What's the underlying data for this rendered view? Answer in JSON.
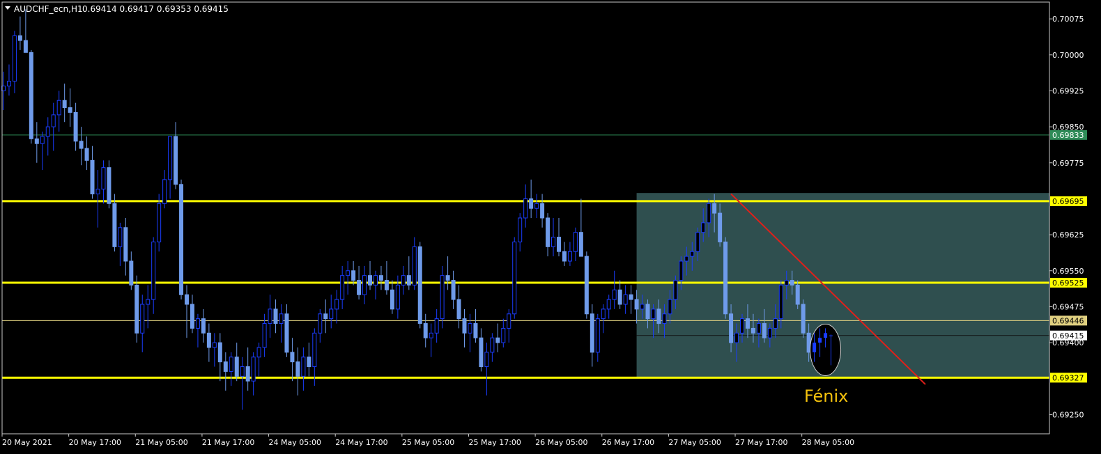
{
  "header": {
    "symbol": "AUDCHF_ecn,H1",
    "ohlc": "0.69414 0.69417 0.69353 0.69415"
  },
  "colors": {
    "background": "#000000",
    "frame": "#ffffff",
    "bull_candle": "#1a3dff",
    "bear_candle": "#6f9bea",
    "support_resistance": "#ffff00",
    "green_level": "#2e8b57",
    "mid_level": "#e0d080",
    "box_fill": "#2f4f4f",
    "trendline": "#e0201a",
    "annotation": "#f4c20d"
  },
  "annotation": {
    "label": "Fénix",
    "marker": "ellipse"
  },
  "chart_data": {
    "type": "candlestick",
    "symbol": "AUDCHF_ecn",
    "timeframe": "H1",
    "ylim": [
      0.6921,
      0.7011
    ],
    "y_ticks": [
      {
        "value": 0.70075,
        "label": "0.70075"
      },
      {
        "value": 0.7,
        "label": "0.70000"
      },
      {
        "value": 0.69925,
        "label": "0.69925"
      },
      {
        "value": 0.6985,
        "label": "0.69850"
      },
      {
        "value": 0.69775,
        "label": "0.69775"
      },
      {
        "value": 0.69625,
        "label": "0.69625"
      },
      {
        "value": 0.6955,
        "label": "0.69550"
      },
      {
        "value": 0.69475,
        "label": "0.69475"
      },
      {
        "value": 0.694,
        "label": "0.69400"
      },
      {
        "value": 0.6925,
        "label": "0.69250"
      }
    ],
    "x_ticks": [
      {
        "bar": 0,
        "label": "20 May 2021"
      },
      {
        "bar": 12,
        "label": "20 May 17:00"
      },
      {
        "bar": 24,
        "label": "21 May 05:00"
      },
      {
        "bar": 36,
        "label": "21 May 17:00"
      },
      {
        "bar": 48,
        "label": "24 May 05:00"
      },
      {
        "bar": 60,
        "label": "24 May 17:00"
      },
      {
        "bar": 72,
        "label": "25 May 05:00"
      },
      {
        "bar": 84,
        "label": "25 May 17:00"
      },
      {
        "bar": 96,
        "label": "26 May 05:00"
      },
      {
        "bar": 108,
        "label": "26 May 17:00"
      },
      {
        "bar": 120,
        "label": "27 May 05:00"
      },
      {
        "bar": 132,
        "label": "27 May 17:00"
      },
      {
        "bar": 144,
        "label": "28 May 05:00"
      }
    ],
    "levels": [
      {
        "name": "resistance",
        "value": 0.69833,
        "label": "0.69833",
        "style": "green"
      },
      {
        "name": "resistance",
        "value": 0.69695,
        "label": "0.69695",
        "style": "yellow"
      },
      {
        "name": "support",
        "value": 0.69525,
        "label": "0.69525",
        "style": "yellow"
      },
      {
        "name": "mid",
        "value": 0.69446,
        "label": "0.69446",
        "style": "thin"
      },
      {
        "name": "support",
        "value": 0.69327,
        "label": "0.69327",
        "style": "yellow"
      }
    ],
    "current_price": {
      "value": 0.69415,
      "label": "0.69415"
    },
    "range_box": {
      "bar_start": 114,
      "bar_end": 190,
      "price_top": 0.69712,
      "price_bottom": 0.69328
    },
    "trendline": {
      "bar1": 131,
      "price1": 0.6971,
      "bar2": 166,
      "price2": 0.69313
    },
    "fenix_marker": {
      "bar": 148,
      "price": 0.69385
    },
    "candles": [
      [
        0.69925,
        0.69965,
        0.69885,
        0.69935
      ],
      [
        0.69935,
        0.6998,
        0.69915,
        0.69945
      ],
      [
        0.69945,
        0.7005,
        0.6992,
        0.7004
      ],
      [
        0.7004,
        0.7008,
        0.7001,
        0.7003
      ],
      [
        0.7003,
        0.70095,
        0.7001,
        0.70005
      ],
      [
        0.70005,
        0.7001,
        0.69815,
        0.69825
      ],
      [
        0.69825,
        0.6986,
        0.69775,
        0.69815
      ],
      [
        0.69815,
        0.6984,
        0.6976,
        0.6983
      ],
      [
        0.6983,
        0.6987,
        0.6979,
        0.6985
      ],
      [
        0.6985,
        0.699,
        0.698,
        0.69875
      ],
      [
        0.69875,
        0.69925,
        0.6984,
        0.69905
      ],
      [
        0.69905,
        0.6994,
        0.6986,
        0.6989
      ],
      [
        0.6989,
        0.6993,
        0.6985,
        0.6988
      ],
      [
        0.6988,
        0.699,
        0.698,
        0.6982
      ],
      [
        0.6982,
        0.6985,
        0.6977,
        0.69805
      ],
      [
        0.69805,
        0.6983,
        0.6976,
        0.6978
      ],
      [
        0.6978,
        0.6981,
        0.697,
        0.6971
      ],
      [
        0.6971,
        0.6976,
        0.6964,
        0.6972
      ],
      [
        0.6972,
        0.6978,
        0.6969,
        0.69765
      ],
      [
        0.69765,
        0.6978,
        0.6968,
        0.6969
      ],
      [
        0.6969,
        0.6971,
        0.6959,
        0.696
      ],
      [
        0.696,
        0.6965,
        0.6956,
        0.6964
      ],
      [
        0.6964,
        0.6966,
        0.6954,
        0.6957
      ],
      [
        0.6957,
        0.6959,
        0.6951,
        0.6952
      ],
      [
        0.6952,
        0.6954,
        0.694,
        0.6942
      ],
      [
        0.6942,
        0.695,
        0.6938,
        0.6948
      ],
      [
        0.6948,
        0.6952,
        0.6943,
        0.6949
      ],
      [
        0.6949,
        0.6962,
        0.6946,
        0.6961
      ],
      [
        0.6961,
        0.6971,
        0.6959,
        0.6969
      ],
      [
        0.6969,
        0.6976,
        0.6968,
        0.6974
      ],
      [
        0.6974,
        0.6983,
        0.697,
        0.6983
      ],
      [
        0.6983,
        0.6986,
        0.6972,
        0.6973
      ],
      [
        0.6973,
        0.6974,
        0.6949,
        0.695
      ],
      [
        0.695,
        0.6952,
        0.6941,
        0.6948
      ],
      [
        0.6948,
        0.695,
        0.6942,
        0.6943
      ],
      [
        0.6943,
        0.6946,
        0.6939,
        0.6945
      ],
      [
        0.6945,
        0.6947,
        0.694,
        0.6942
      ],
      [
        0.6942,
        0.6944,
        0.6936,
        0.6939
      ],
      [
        0.6939,
        0.6942,
        0.6935,
        0.694
      ],
      [
        0.694,
        0.6942,
        0.6932,
        0.6936
      ],
      [
        0.6936,
        0.6938,
        0.693,
        0.6934
      ],
      [
        0.6934,
        0.6938,
        0.6931,
        0.6937
      ],
      [
        0.6937,
        0.694,
        0.6932,
        0.6933
      ],
      [
        0.6933,
        0.6937,
        0.6926,
        0.6935
      ],
      [
        0.6935,
        0.6939,
        0.693,
        0.6932
      ],
      [
        0.6932,
        0.6938,
        0.6929,
        0.6937
      ],
      [
        0.6937,
        0.694,
        0.6933,
        0.6939
      ],
      [
        0.6939,
        0.6946,
        0.6937,
        0.6944
      ],
      [
        0.6944,
        0.695,
        0.6941,
        0.6947
      ],
      [
        0.6947,
        0.6949,
        0.6942,
        0.6944
      ],
      [
        0.6944,
        0.6948,
        0.694,
        0.6946
      ],
      [
        0.6946,
        0.6948,
        0.6937,
        0.6938
      ],
      [
        0.6938,
        0.6941,
        0.6932,
        0.6936
      ],
      [
        0.6936,
        0.6939,
        0.6929,
        0.6933
      ],
      [
        0.6933,
        0.6939,
        0.693,
        0.6937
      ],
      [
        0.6937,
        0.694,
        0.6933,
        0.6935
      ],
      [
        0.6935,
        0.6943,
        0.6931,
        0.6942
      ],
      [
        0.6942,
        0.6947,
        0.694,
        0.6946
      ],
      [
        0.6946,
        0.6949,
        0.6942,
        0.6945
      ],
      [
        0.6945,
        0.695,
        0.6943,
        0.6947
      ],
      [
        0.6947,
        0.6951,
        0.6944,
        0.6949
      ],
      [
        0.6949,
        0.6956,
        0.6947,
        0.6954
      ],
      [
        0.6954,
        0.6957,
        0.695,
        0.6955
      ],
      [
        0.6955,
        0.6957,
        0.6952,
        0.6953
      ],
      [
        0.6953,
        0.6956,
        0.6949,
        0.695
      ],
      [
        0.695,
        0.6956,
        0.6948,
        0.6954
      ],
      [
        0.6954,
        0.6957,
        0.6951,
        0.6952
      ],
      [
        0.6952,
        0.6955,
        0.6949,
        0.6954
      ],
      [
        0.6954,
        0.6956,
        0.6951,
        0.6953
      ],
      [
        0.6953,
        0.6957,
        0.695,
        0.6951
      ],
      [
        0.6951,
        0.6953,
        0.6946,
        0.6947
      ],
      [
        0.6947,
        0.6954,
        0.6945,
        0.6952
      ],
      [
        0.6952,
        0.6956,
        0.695,
        0.6954
      ],
      [
        0.6954,
        0.6958,
        0.6951,
        0.6952
      ],
      [
        0.6952,
        0.6962,
        0.6951,
        0.696
      ],
      [
        0.696,
        0.6961,
        0.6943,
        0.6944
      ],
      [
        0.6944,
        0.6946,
        0.6939,
        0.6941
      ],
      [
        0.6941,
        0.6944,
        0.6937,
        0.6942
      ],
      [
        0.6942,
        0.6947,
        0.694,
        0.6945
      ],
      [
        0.6945,
        0.6956,
        0.6943,
        0.6954
      ],
      [
        0.6954,
        0.6958,
        0.6951,
        0.6953
      ],
      [
        0.6953,
        0.6955,
        0.6947,
        0.6949
      ],
      [
        0.6949,
        0.6952,
        0.6943,
        0.6945
      ],
      [
        0.6945,
        0.6947,
        0.6939,
        0.6942
      ],
      [
        0.6942,
        0.6946,
        0.6938,
        0.6944
      ],
      [
        0.6944,
        0.6947,
        0.694,
        0.6941
      ],
      [
        0.6941,
        0.6943,
        0.6934,
        0.6935
      ],
      [
        0.6935,
        0.694,
        0.6929,
        0.6938
      ],
      [
        0.6938,
        0.6942,
        0.6936,
        0.6941
      ],
      [
        0.6941,
        0.6944,
        0.6938,
        0.694
      ],
      [
        0.694,
        0.6945,
        0.6939,
        0.6943
      ],
      [
        0.6943,
        0.6947,
        0.694,
        0.6946
      ],
      [
        0.6946,
        0.6962,
        0.6945,
        0.6961
      ],
      [
        0.6961,
        0.6967,
        0.6959,
        0.6966
      ],
      [
        0.6966,
        0.6973,
        0.6964,
        0.697
      ],
      [
        0.697,
        0.6974,
        0.6966,
        0.6968
      ],
      [
        0.6968,
        0.6971,
        0.6966,
        0.6969
      ],
      [
        0.6969,
        0.6971,
        0.6964,
        0.6966
      ],
      [
        0.6966,
        0.6967,
        0.6958,
        0.696
      ],
      [
        0.696,
        0.6966,
        0.6958,
        0.6962
      ],
      [
        0.6962,
        0.6966,
        0.6958,
        0.6959
      ],
      [
        0.6959,
        0.6961,
        0.6956,
        0.6957
      ],
      [
        0.6957,
        0.6961,
        0.6956,
        0.6959
      ],
      [
        0.6959,
        0.6964,
        0.6957,
        0.6963
      ],
      [
        0.6963,
        0.697,
        0.696,
        0.6958
      ],
      [
        0.6958,
        0.6959,
        0.6945,
        0.6946
      ],
      [
        0.6946,
        0.6948,
        0.6935,
        0.6938
      ],
      [
        0.6938,
        0.6946,
        0.6936,
        0.6945
      ],
      [
        0.6945,
        0.6948,
        0.6942,
        0.6947
      ],
      [
        0.6947,
        0.695,
        0.6945,
        0.6949
      ],
      [
        0.6949,
        0.6955,
        0.6947,
        0.6951
      ],
      [
        0.6951,
        0.6953,
        0.6947,
        0.6948
      ],
      [
        0.6948,
        0.6952,
        0.6946,
        0.695
      ],
      [
        0.695,
        0.6952,
        0.6946,
        0.6949
      ],
      [
        0.6949,
        0.6951,
        0.6944,
        0.6947
      ],
      [
        0.6947,
        0.695,
        0.6945,
        0.6948
      ],
      [
        0.6948,
        0.6949,
        0.6943,
        0.6945
      ],
      [
        0.6945,
        0.6948,
        0.6941,
        0.6947
      ],
      [
        0.6947,
        0.6949,
        0.6942,
        0.6944
      ],
      [
        0.6944,
        0.6948,
        0.6941,
        0.6946
      ],
      [
        0.6946,
        0.6951,
        0.6944,
        0.6949
      ],
      [
        0.6949,
        0.6954,
        0.6947,
        0.6953
      ],
      [
        0.6953,
        0.6958,
        0.6951,
        0.6957
      ],
      [
        0.6957,
        0.696,
        0.6954,
        0.6958
      ],
      [
        0.6958,
        0.6961,
        0.6955,
        0.6959
      ],
      [
        0.6959,
        0.6964,
        0.6957,
        0.6963
      ],
      [
        0.6963,
        0.6968,
        0.6961,
        0.6965
      ],
      [
        0.6965,
        0.697,
        0.6962,
        0.6969
      ],
      [
        0.6969,
        0.6971,
        0.6963,
        0.6967
      ],
      [
        0.6967,
        0.6969,
        0.696,
        0.6961
      ],
      [
        0.6961,
        0.6962,
        0.6945,
        0.6946
      ],
      [
        0.6946,
        0.6948,
        0.6938,
        0.694
      ],
      [
        0.694,
        0.6944,
        0.6936,
        0.6942
      ],
      [
        0.6942,
        0.6946,
        0.694,
        0.6945
      ],
      [
        0.6945,
        0.6948,
        0.6941,
        0.6943
      ],
      [
        0.6943,
        0.6946,
        0.694,
        0.6942
      ],
      [
        0.6942,
        0.6945,
        0.6939,
        0.6944
      ],
      [
        0.6944,
        0.6947,
        0.694,
        0.6941
      ],
      [
        0.6941,
        0.6944,
        0.6939,
        0.6943
      ],
      [
        0.6943,
        0.6948,
        0.6941,
        0.6945
      ],
      [
        0.6945,
        0.6953,
        0.6943,
        0.6952
      ],
      [
        0.6952,
        0.6955,
        0.6949,
        0.6953
      ],
      [
        0.6953,
        0.6955,
        0.695,
        0.6952
      ],
      [
        0.6952,
        0.6953,
        0.6947,
        0.6948
      ],
      [
        0.6948,
        0.6949,
        0.6941,
        0.6942
      ],
      [
        0.6942,
        0.6944,
        0.6936,
        0.6938
      ],
      [
        0.6938,
        0.6942,
        0.6936,
        0.694
      ],
      [
        0.694,
        0.6943,
        0.6937,
        0.6941
      ],
      [
        0.6941,
        0.6943,
        0.6939,
        0.6942
      ],
      [
        0.69414,
        0.69417,
        0.69353,
        0.69415
      ]
    ]
  }
}
